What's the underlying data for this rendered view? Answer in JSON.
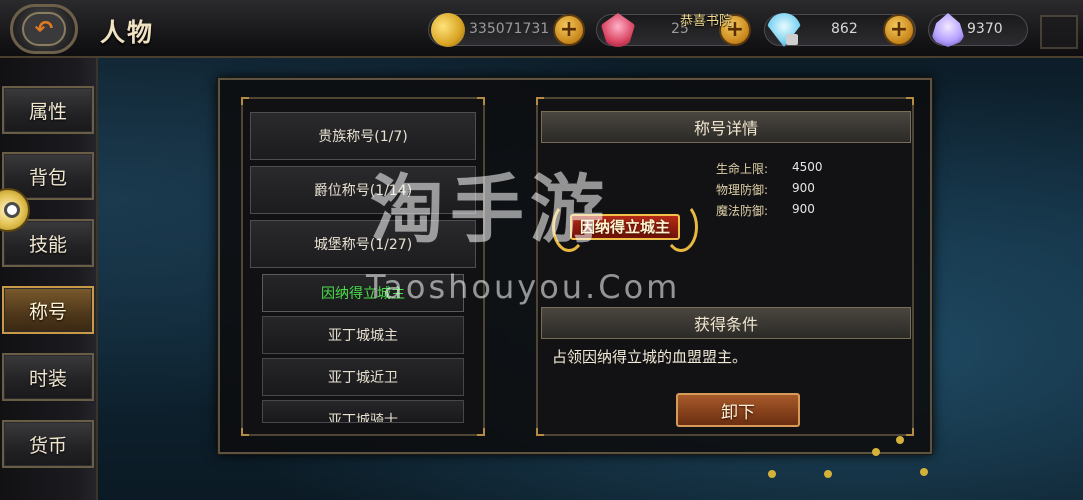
{
  "header": {
    "back_icon": "back-arrow-icon",
    "title": "人物",
    "announcement": "恭喜书院",
    "resources": [
      {
        "name": "gold",
        "icon": "coin-icon",
        "value": "335071731"
      },
      {
        "name": "ruby",
        "icon": "ruby-icon",
        "value": "25"
      },
      {
        "name": "diamond",
        "icon": "diamond-icon",
        "value": "862"
      },
      {
        "name": "crystal",
        "icon": "crystal-icon",
        "value": "9370"
      }
    ],
    "plus_label": "+"
  },
  "sidebar": {
    "items": [
      {
        "label": "属性",
        "active": false
      },
      {
        "label": "背包",
        "active": false
      },
      {
        "label": "技能",
        "active": false
      },
      {
        "label": "称号",
        "active": true
      },
      {
        "label": "时装",
        "active": false
      },
      {
        "label": "货币",
        "active": false
      }
    ]
  },
  "title_list": {
    "categories": [
      {
        "label": "贵族称号(1/7)"
      },
      {
        "label": "爵位称号(1/14)"
      },
      {
        "label": "城堡称号(1/27)"
      }
    ],
    "titles": [
      {
        "label": "因纳得立城主",
        "selected": true
      },
      {
        "label": "亚丁城城主",
        "selected": false
      },
      {
        "label": "亚丁城近卫",
        "selected": false
      },
      {
        "label": "亚丁城骑士",
        "selected": false
      }
    ]
  },
  "detail": {
    "header": "称号详情",
    "badge_text": "因纳得立城主",
    "stats": [
      {
        "label": "生命上限:",
        "value": "4500"
      },
      {
        "label": "物理防御:",
        "value": "900"
      },
      {
        "label": "魔法防御:",
        "value": "900"
      }
    ],
    "condition_header": "获得条件",
    "condition_text": "占领因纳得立城的血盟盟主。",
    "unequip_label": "卸下"
  },
  "watermark": {
    "main": "淘手游",
    "sub": "Taoshouyou.Com"
  },
  "colors": {
    "accent_gold": "#c89a48",
    "selected_green": "#49e04a",
    "button_orange": "#a85a2a"
  }
}
